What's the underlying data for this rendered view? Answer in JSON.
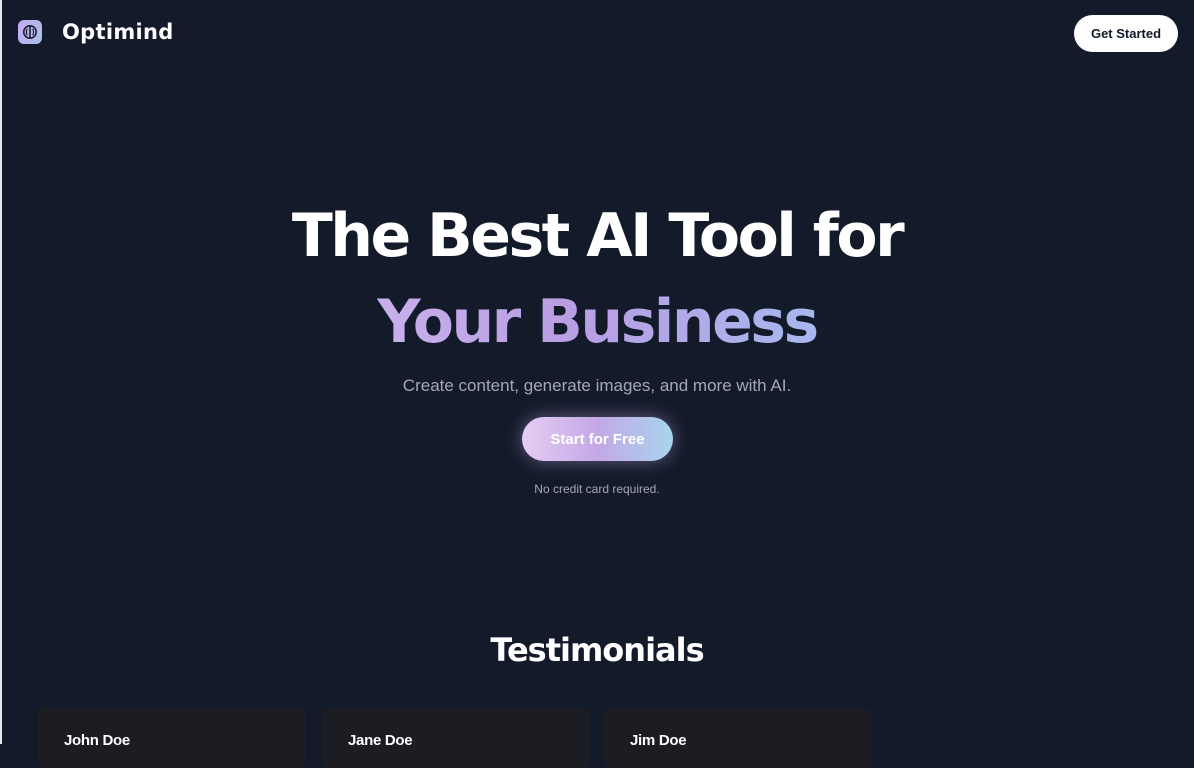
{
  "header": {
    "brand": "Optimind",
    "cta_label": "Get Started"
  },
  "hero": {
    "title_line1": "The Best AI Tool for",
    "title_line2": "Your Business",
    "subtitle": "Create content, generate images, and more with AI.",
    "cta_label": "Start for Free",
    "cta_note": "No credit card required."
  },
  "testimonials": {
    "heading": "Testimonials",
    "items": [
      {
        "name": "John Doe"
      },
      {
        "name": "Jane Doe"
      },
      {
        "name": "Jim Doe"
      }
    ]
  },
  "colors": {
    "background": "#131a2a",
    "gradient_start": "#c8b0ec",
    "gradient_end": "#a8b8ee",
    "muted_text": "#a3a8b4",
    "card_background": "#1c1d23"
  },
  "icons": {
    "logo": "brain-logo-icon"
  }
}
